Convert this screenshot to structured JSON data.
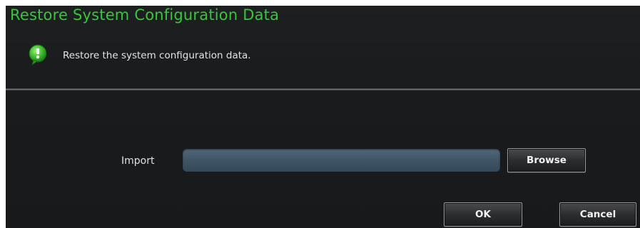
{
  "dialog": {
    "title": "Restore System Configuration Data",
    "subtitle": "Restore the system configuration data.",
    "info_icon": "info-speech-bubble-icon"
  },
  "form": {
    "import_label": "Import",
    "import_value": "",
    "browse_label": "Browse"
  },
  "footer": {
    "ok_label": "OK",
    "cancel_label": "Cancel"
  },
  "colors": {
    "title": "#39c53c",
    "background": "#1b1d1f",
    "input": "#4a6070"
  }
}
